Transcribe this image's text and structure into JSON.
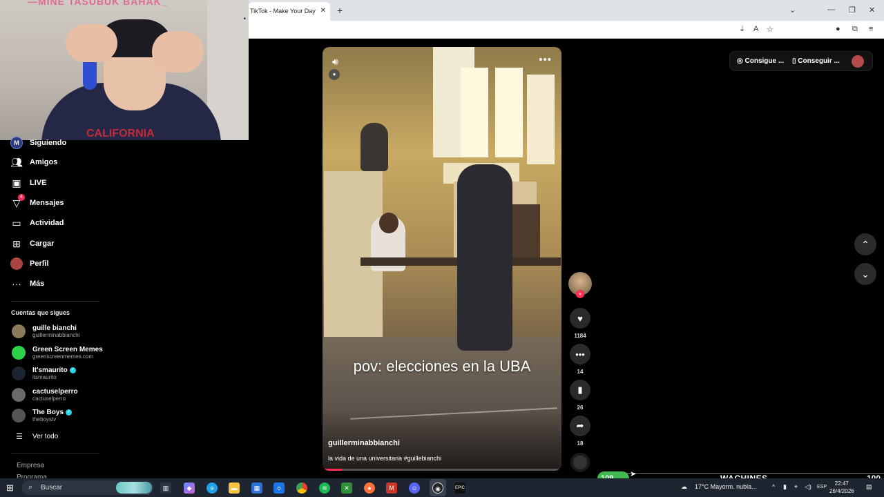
{
  "browser": {
    "tab_title": "TikTok - Make Your Day",
    "tab_close": "✕",
    "new_tab": "+",
    "window_controls": [
      "⌄",
      "—",
      "❐",
      "✕"
    ]
  },
  "webcam": {
    "overlay_text": "—MINE TASUBUK BAHAK_",
    "hoodie_text": "CALIFORNIA"
  },
  "sidebar": {
    "nav": [
      {
        "label": "Siguiendo",
        "icon": "following-avatar-icon",
        "avatar_letter": "M"
      },
      {
        "label": "Amigos",
        "icon": "friends-icon"
      },
      {
        "label": "LIVE",
        "icon": "live-icon"
      },
      {
        "label": "Mensajes",
        "icon": "messages-icon",
        "badge": "4"
      },
      {
        "label": "Actividad",
        "icon": "activity-icon"
      },
      {
        "label": "Cargar",
        "icon": "upload-icon"
      },
      {
        "label": "Perfil",
        "icon": "profile-avatar-icon"
      },
      {
        "label": "Más",
        "icon": "more-dots-icon"
      }
    ],
    "following_title": "Cuentas que sigues",
    "accounts": [
      {
        "name": "guille bianchi",
        "handle": "guillerminabbianchi",
        "verified": false,
        "color": "#8a7a5a"
      },
      {
        "name": "Green Screen Memes",
        "handle": "greenscreenmemes.com",
        "verified": false,
        "color": "#2bd24a"
      },
      {
        "name": "It'smaurito",
        "handle": "itsmaurito",
        "verified": true,
        "color": "#1b2430"
      },
      {
        "name": "cactuselperro",
        "handle": "cactuselperro",
        "verified": false,
        "color": "#6a6a6a"
      },
      {
        "name": "The Boys",
        "handle": "theboystv",
        "verified": true,
        "color": "#555"
      }
    ],
    "see_all": "Ver todo",
    "footer": [
      "Empresa",
      "Programa"
    ]
  },
  "video": {
    "caption": "pov: elecciones en la UBA",
    "author": "guillerminabbianchi",
    "description": "la vida de una universitaria #guillebianchi",
    "progress": 0.08
  },
  "actions": {
    "likes": "1184",
    "comments": "14",
    "saves": "26",
    "shares": "18"
  },
  "top_pill": {
    "item1": "Consigue ...",
    "item2": "Conseguir ..."
  },
  "overlay": {
    "counter": "109",
    "label": "WACHINES",
    "number": "100"
  },
  "taskbar": {
    "search_placeholder": "Buscar",
    "weather": "17°C  Mayorm. nubla...",
    "lang": "ESP",
    "time": "22:47",
    "date": "26/4/2026"
  }
}
